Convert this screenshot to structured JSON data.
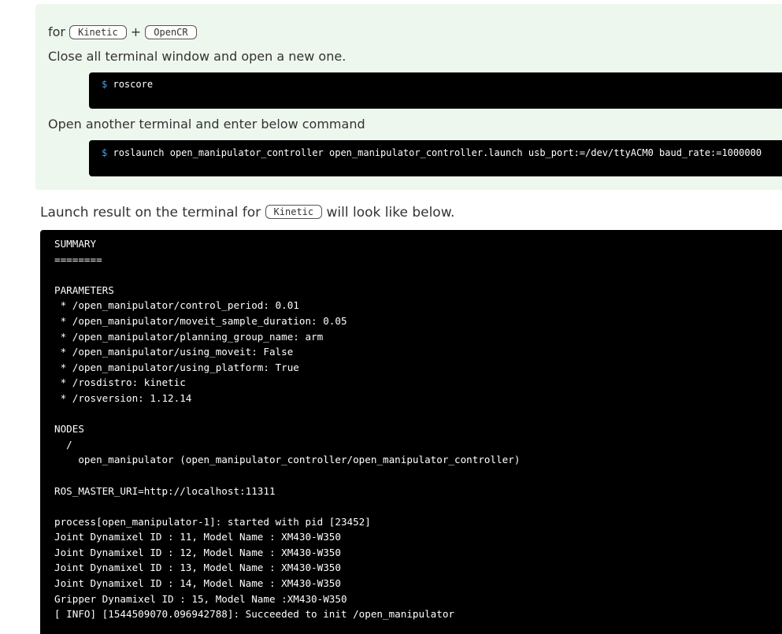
{
  "notice": {
    "for_prefix": "for",
    "badge_kinetic": "Kinetic",
    "plus": "+",
    "badge_opencr": "OpenCR",
    "step1_text": "Close all terminal window and open a new one.",
    "cmd1_prompt": "$",
    "cmd1_text": "roscore",
    "step2_text": "Open another terminal and enter below command",
    "cmd2_prompt": "$",
    "cmd2_text": "roslaunch open_manipulator_controller open_manipulator_controller.launch usb_port:=/dev/ttyACM0 baud_rate:=1000000"
  },
  "result": {
    "prefix": "Launch result on the terminal for",
    "badge": "Kinetic",
    "suffix": "will look like below."
  },
  "terminal_output": [
    "SUMMARY",
    "========",
    "",
    "PARAMETERS",
    " * /open_manipulator/control_period: 0.01",
    " * /open_manipulator/moveit_sample_duration: 0.05",
    " * /open_manipulator/planning_group_name: arm",
    " * /open_manipulator/using_moveit: False",
    " * /open_manipulator/using_platform: True",
    " * /rosdistro: kinetic",
    " * /rosversion: 1.12.14",
    "",
    "NODES",
    "  /",
    "    open_manipulator (open_manipulator_controller/open_manipulator_controller)",
    "",
    "ROS_MASTER_URI=http://localhost:11311",
    "",
    "process[open_manipulator-1]: started with pid [23452]",
    "Joint Dynamixel ID : 11, Model Name : XM430-W350",
    "Joint Dynamixel ID : 12, Model Name : XM430-W350",
    "Joint Dynamixel ID : 13, Model Name : XM430-W350",
    "Joint Dynamixel ID : 14, Model Name : XM430-W350",
    "Gripper Dynamixel ID : 15, Model Name :XM430-W350",
    "[ INFO] [1544509070.096942788]: Succeeded to init /open_manipulator"
  ]
}
